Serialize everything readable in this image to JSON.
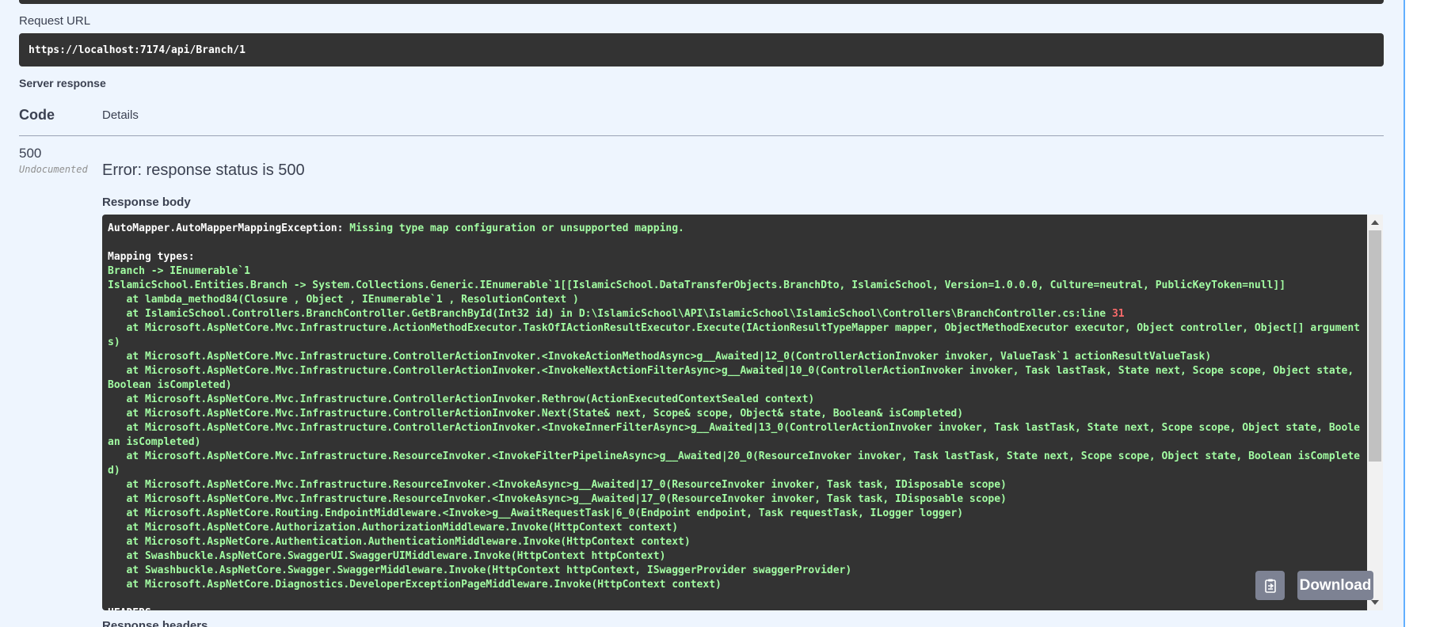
{
  "request": {
    "label": "Request URL",
    "url": "https://localhost:7174/api/Branch/1"
  },
  "server_response": {
    "label": "Server response",
    "col_code": "Code",
    "col_details": "Details",
    "code": "500",
    "code_note": "Undocumented",
    "error_message": "Error: response status is 500",
    "body_label": "Response body",
    "body_lines": [
      {
        "w": "AutoMapper.AutoMapperMappingException:",
        "g": " Missing type map configuration or unsupported mapping."
      },
      {
        "g": ""
      },
      {
        "w": "Mapping types:"
      },
      {
        "g": "Branch -> IEnumerable`1"
      },
      {
        "g": "IslamicSchool.Entities.Branch -> System.Collections.Generic.IEnumerable`1[[IslamicSchool.DataTransferObjects.BranchDto, IslamicSchool, Version=1.0.0.0, Culture=neutral, PublicKeyToken=null]]"
      },
      {
        "g": "   at lambda_method84(Closure , Object , IEnumerable`1 , ResolutionContext )"
      },
      {
        "g": "   at IslamicSchool.Controllers.BranchController.GetBranchById(Int32 id) in D:\\IslamicSchool\\API\\IslamicSchool\\IslamicSchool\\Controllers\\BranchController.cs:line ",
        "r": "31"
      },
      {
        "g": "   at Microsoft.AspNetCore.Mvc.Infrastructure.ActionMethodExecutor.TaskOfIActionResultExecutor.Execute(IActionResultTypeMapper mapper, ObjectMethodExecutor executor, Object controller, Object[] arguments)"
      },
      {
        "g": "   at Microsoft.AspNetCore.Mvc.Infrastructure.ControllerActionInvoker.<InvokeActionMethodAsync>g__Awaited|12_0(ControllerActionInvoker invoker, ValueTask`1 actionResultValueTask)"
      },
      {
        "g": "   at Microsoft.AspNetCore.Mvc.Infrastructure.ControllerActionInvoker.<InvokeNextActionFilterAsync>g__Awaited|10_0(ControllerActionInvoker invoker, Task lastTask, State next, Scope scope, Object state, Boolean isCompleted)"
      },
      {
        "g": "   at Microsoft.AspNetCore.Mvc.Infrastructure.ControllerActionInvoker.Rethrow(ActionExecutedContextSealed context)"
      },
      {
        "g": "   at Microsoft.AspNetCore.Mvc.Infrastructure.ControllerActionInvoker.Next(State& next, Scope& scope, Object& state, Boolean& isCompleted)"
      },
      {
        "g": "   at Microsoft.AspNetCore.Mvc.Infrastructure.ControllerActionInvoker.<InvokeInnerFilterAsync>g__Awaited|13_0(ControllerActionInvoker invoker, Task lastTask, State next, Scope scope, Object state, Boolean isCompleted)"
      },
      {
        "g": "   at Microsoft.AspNetCore.Mvc.Infrastructure.ResourceInvoker.<InvokeFilterPipelineAsync>g__Awaited|20_0(ResourceInvoker invoker, Task lastTask, State next, Scope scope, Object state, Boolean isCompleted)"
      },
      {
        "g": "   at Microsoft.AspNetCore.Mvc.Infrastructure.ResourceInvoker.<InvokeAsync>g__Awaited|17_0(ResourceInvoker invoker, Task task, IDisposable scope)"
      },
      {
        "g": "   at Microsoft.AspNetCore.Mvc.Infrastructure.ResourceInvoker.<InvokeAsync>g__Awaited|17_0(ResourceInvoker invoker, Task task, IDisposable scope)"
      },
      {
        "g": "   at Microsoft.AspNetCore.Routing.EndpointMiddleware.<Invoke>g__AwaitRequestTask|6_0(Endpoint endpoint, Task requestTask, ILogger logger)"
      },
      {
        "g": "   at Microsoft.AspNetCore.Authorization.AuthorizationMiddleware.Invoke(HttpContext context)"
      },
      {
        "g": "   at Microsoft.AspNetCore.Authentication.AuthenticationMiddleware.Invoke(HttpContext context)"
      },
      {
        "g": "   at Swashbuckle.AspNetCore.SwaggerUI.SwaggerUIMiddleware.Invoke(HttpContext httpContext)"
      },
      {
        "g": "   at Swashbuckle.AspNetCore.Swagger.SwaggerMiddleware.Invoke(HttpContext httpContext, ISwaggerProvider swaggerProvider)"
      },
      {
        "g": "   at Microsoft.AspNetCore.Diagnostics.DeveloperExceptionPageMiddleware.Invoke(HttpContext context)"
      },
      {
        "g": ""
      },
      {
        "w": "HEADERS"
      }
    ],
    "download_label": "Download",
    "headers_label": "Response headers"
  },
  "colors": {
    "panel_bg": "#eef5fe",
    "panel_border": "#61affe",
    "code_bg": "#333333",
    "code_text": "#a2fca2",
    "code_key": "#ffffff",
    "code_number": "#f96b6b",
    "button_bg": "#7d8293"
  },
  "icons": {
    "copy": "clipboard-copy-icon"
  }
}
